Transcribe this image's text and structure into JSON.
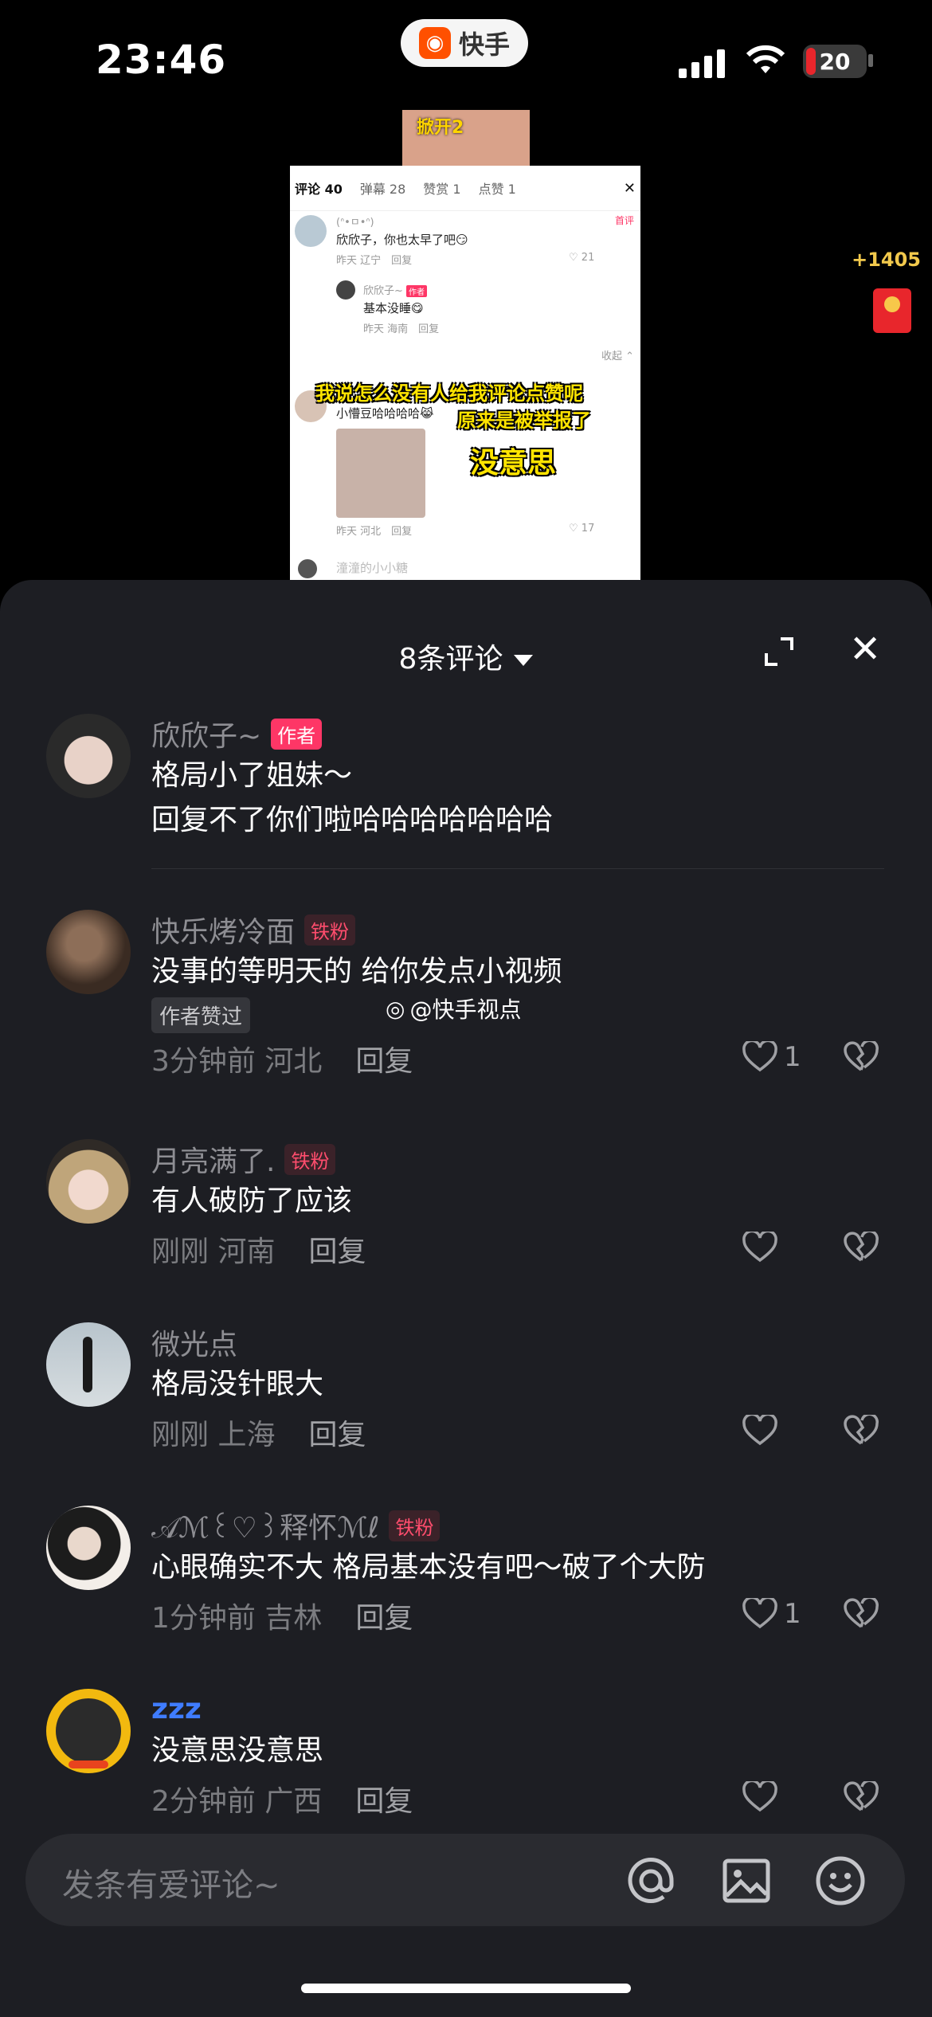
{
  "status_bar": {
    "time": "23:46",
    "app_name": "快手",
    "battery": "20"
  },
  "embed": {
    "thumb_text": "掀开2",
    "tabs": [
      "评论 40",
      "弹幕 28",
      "赞赏 1",
      "点赞 1"
    ],
    "c1": {
      "name": "(ᐢ•ㅁ•ᐢ)",
      "text": "欣欣子，你也太早了吧😏",
      "meta": "昨天 辽宁",
      "reply": "回复",
      "likes": "21",
      "tag": "首评"
    },
    "c2": {
      "name": "欣欣子~",
      "tag": "作者",
      "text": "基本没睡😋",
      "meta": "昨天 海南",
      "reply": "回复"
    },
    "collapse": "收起",
    "c3": {
      "text": "小懵豆哈哈哈哈😹",
      "meta": "昨天 河北",
      "reply": "回复",
      "likes": "17"
    },
    "overlay1": "我说怎么没有人给我评论点赞呢",
    "overlay2": "原来是被举报了",
    "overlay3": "没意思",
    "c4_name": "潼潼的小小糖"
  },
  "side": {
    "count": "+1405"
  },
  "panel": {
    "title": "8条评论",
    "comments": [
      {
        "name": "欣欣子~",
        "badge": "作者",
        "lines": [
          "格局小了姐妹～",
          "回复不了你们啦哈哈哈哈哈哈哈"
        ]
      },
      {
        "name": "快乐烤冷面",
        "badge": "铁粉",
        "lines": [
          "没事的等明天的 给你发点小视频"
        ],
        "extra": "作者赞过",
        "time": "3分钟前 河北",
        "reply": "回复",
        "likes": "1"
      },
      {
        "name": "月亮满了.",
        "badge": "铁粉",
        "lines": [
          "有人破防了应该"
        ],
        "time": "刚刚 河南",
        "reply": "回复",
        "likes": ""
      },
      {
        "name": "微光点",
        "lines": [
          "格局没针眼大"
        ],
        "time": "刚刚 上海",
        "reply": "回复",
        "likes": ""
      },
      {
        "name": "𝒜ℳ꒰♡꒱释怀ℳℓ",
        "badge": "铁粉",
        "lines": [
          "心眼确实不大 格局基本没有吧～破了个大防"
        ],
        "time": "1分钟前 吉林",
        "reply": "回复",
        "likes": "1"
      },
      {
        "name": "zzz",
        "lines": [
          "没意思没意思"
        ],
        "time": "2分钟前 广西",
        "reply": "回复",
        "likes": ""
      }
    ]
  },
  "watermark": "@快手视点",
  "input": {
    "placeholder": "发条有爱评论~"
  },
  "colors": {
    "panel_bg": "#1d1e23",
    "author_badge": "#fe3666",
    "fan_badge_text": "#ff4d6d"
  }
}
